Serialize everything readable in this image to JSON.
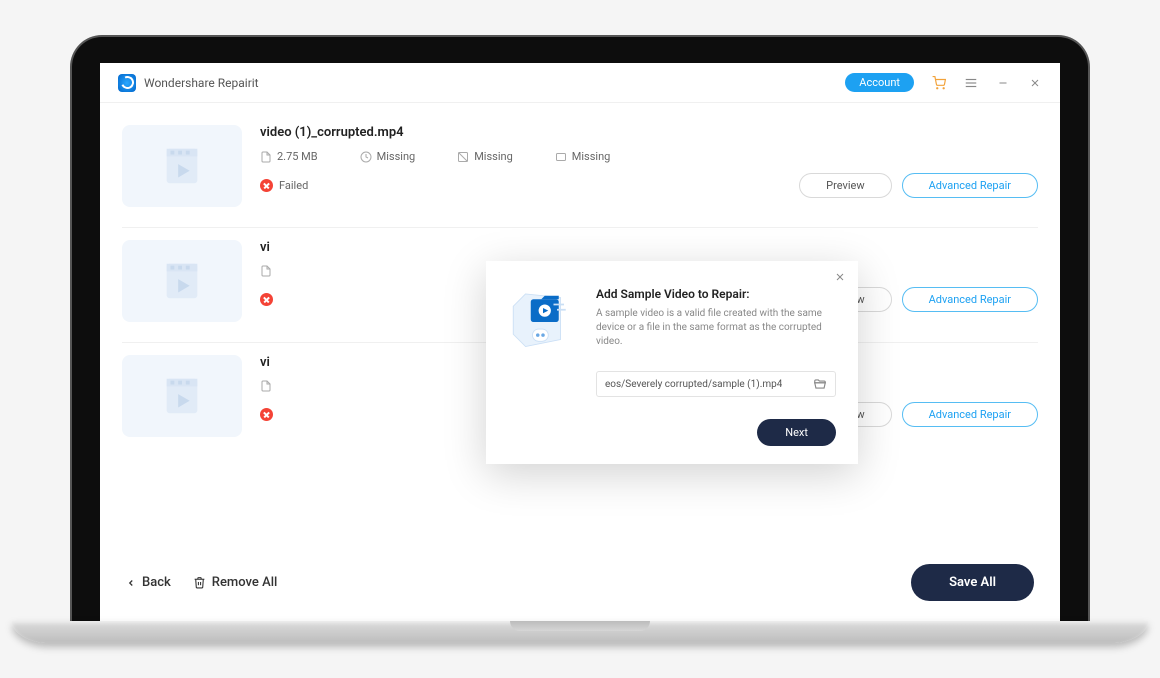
{
  "titlebar": {
    "app_name": "Wondershare Repairit",
    "account_label": "Account"
  },
  "items": [
    {
      "filename": "video (1)_corrupted.mp4",
      "size": "2.75  MB",
      "duration": "Missing",
      "resolution": "Missing",
      "codec": "Missing",
      "status": "Failed",
      "preview_label": "Preview",
      "advanced_label": "Advanced Repair"
    },
    {
      "filename": "vi",
      "size": "",
      "duration": "",
      "resolution": "",
      "codec": "",
      "status": "",
      "preview_label": "iew",
      "advanced_label": "Advanced Repair"
    },
    {
      "filename": "vi",
      "size": "",
      "duration": "",
      "resolution": "",
      "codec": "",
      "status": "",
      "preview_label": "iew",
      "advanced_label": "Advanced Repair"
    }
  ],
  "footer": {
    "back_label": "Back",
    "remove_all_label": "Remove All",
    "save_all_label": "Save All"
  },
  "modal": {
    "title": "Add Sample Video to Repair:",
    "description": "A sample video is a valid file created with the same device or a file in the same format as the corrupted video.",
    "path_value": "eos/Severely corrupted/sample (1).mp4",
    "next_label": "Next"
  }
}
